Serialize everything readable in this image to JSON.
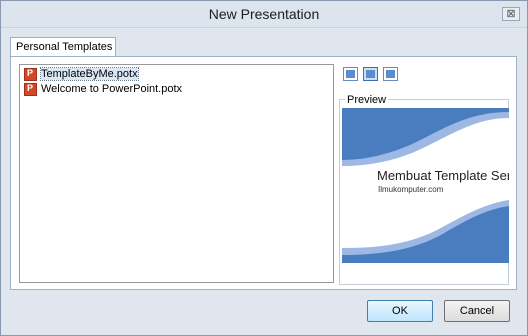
{
  "window": {
    "title": "New Presentation",
    "close_glyph": "⊠"
  },
  "tabs": [
    {
      "label": "Personal Templates"
    }
  ],
  "files": [
    {
      "name": "TemplateByMe.potx",
      "selected": true,
      "icon": "powerpoint-icon"
    },
    {
      "name": "Welcome to PowerPoint.potx",
      "selected": false,
      "icon": "powerpoint-icon"
    }
  ],
  "view_buttons": [
    {
      "name": "large-icons-view-button",
      "active": false
    },
    {
      "name": "list-view-button",
      "active": true
    },
    {
      "name": "details-view-button",
      "active": false
    }
  ],
  "preview": {
    "label": "Preview",
    "slide_title": "Membuat Template Ser",
    "slide_subtitle": "Ilmukomputer.com"
  },
  "buttons": {
    "ok": "OK",
    "cancel": "Cancel"
  },
  "colors": {
    "accent": "#4a7cc0",
    "accent_light": "#9db9e3"
  }
}
